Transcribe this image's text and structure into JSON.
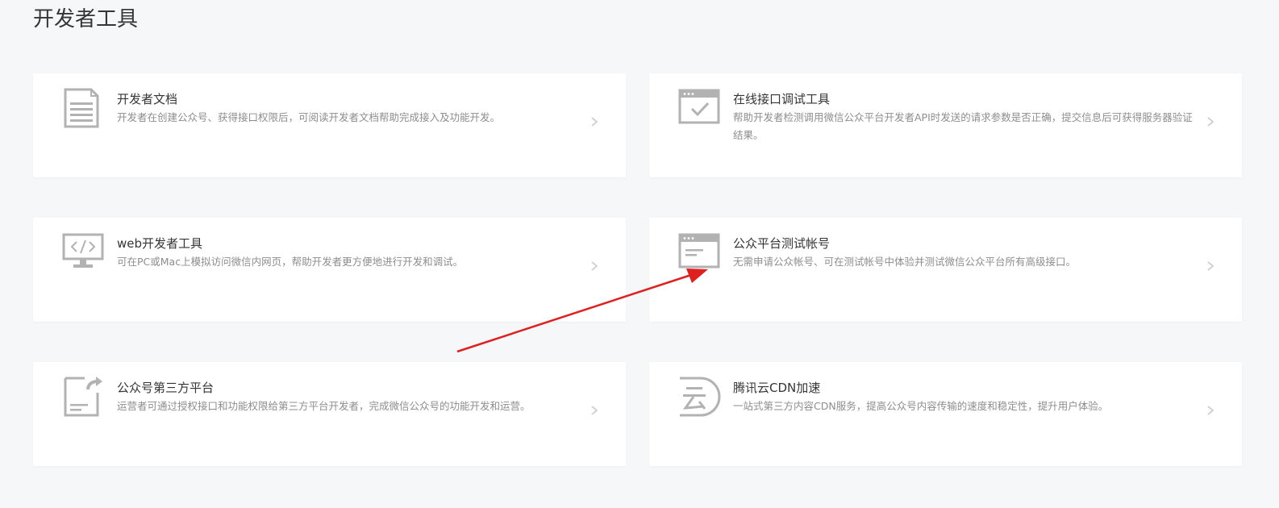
{
  "page": {
    "title": "开发者工具"
  },
  "cards": [
    {
      "id": "docs",
      "title": "开发者文档",
      "desc": "开发者在创建公众号、获得接口权限后，可阅读开发者文档帮助完成接入及功能开发。",
      "icon": "document-icon"
    },
    {
      "id": "api-debug",
      "title": "在线接口调试工具",
      "desc": "帮助开发者检测调用微信公众平台开发者API时发送的请求参数是否正确，提交信息后可获得服务器验证结果。",
      "icon": "browser-check-icon"
    },
    {
      "id": "web-dev",
      "title": "web开发者工具",
      "desc": "可在PC或Mac上模拟访问微信内网页，帮助开发者更方便地进行开发和调试。",
      "icon": "monitor-code-icon"
    },
    {
      "id": "test-account",
      "title": "公众平台测试帐号",
      "desc": "无需申请公众帐号、可在测试帐号中体验并测试微信公众平台所有高级接口。",
      "icon": "browser-window-icon"
    },
    {
      "id": "third-party",
      "title": "公众号第三方平台",
      "desc": "运营者可通过授权接口和功能权限给第三方平台开发者，完成微信公众号的功能开发和运营。",
      "icon": "document-share-icon"
    },
    {
      "id": "cdn",
      "title": "腾讯云CDN加速",
      "desc": "一站式第三方内容CDN服务，提高公众号内容传输的速度和稳定性，提升用户体验。",
      "icon": "cloud-cdn-icon"
    }
  ],
  "colors": {
    "background": "#f6f7f9",
    "card": "#ffffff",
    "icon": "#b2b2b2",
    "title": "#353535",
    "desc": "#8d8d8d",
    "chevron": "#c8c8c8",
    "annotation": "#e02020"
  }
}
